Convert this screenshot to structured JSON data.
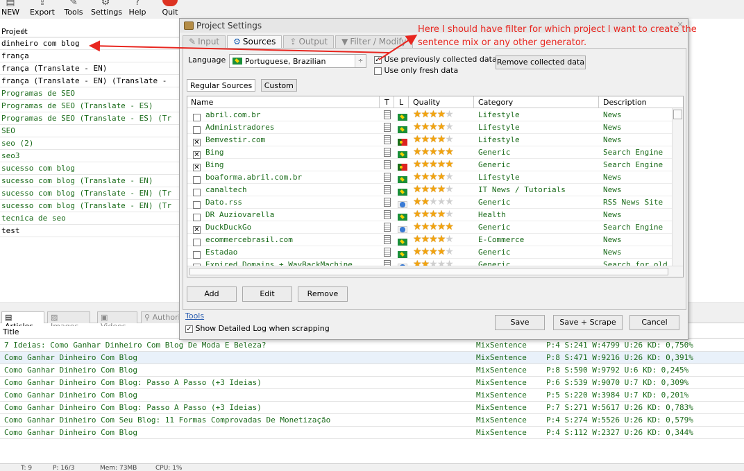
{
  "toolbar": {
    "items": [
      {
        "label": "NEW",
        "icon": "new-icon"
      },
      {
        "label": "Export",
        "icon": "export-icon"
      },
      {
        "label": "Tools",
        "icon": "tools-icon"
      },
      {
        "label": "Settings",
        "icon": "settings-icon"
      },
      {
        "label": "Help",
        "icon": "help-icon"
      },
      {
        "label": "Quit",
        "icon": "quit-icon"
      }
    ]
  },
  "projects": {
    "header": "Project",
    "items": [
      "dinheiro com blog",
      "frança",
      "frança (Translate - EN)",
      "frança (Translate - EN) (Translate -",
      "Programas de SEO",
      "Programas de SEO (Translate - ES)",
      "Programas de SEO (Translate - ES) (Tr",
      "SEO",
      "seo (2)",
      "seo3",
      "sucesso com blog",
      "sucesso com blog (Translate - EN)",
      "sucesso com blog (Translate - EN) (Tr",
      "sucesso com blog (Translate - EN) (Tr",
      "tecnica de seo",
      "test"
    ]
  },
  "dialog": {
    "title": "Project Settings",
    "tabs": [
      "Input",
      "Sources",
      "Output",
      "Filter / Modify"
    ],
    "active_tab": "Sources",
    "language_label": "Language",
    "language_value": "Portuguese, Brazilian",
    "use_previous": "Use previously collected data",
    "use_previous_checked": true,
    "use_fresh": "Use only fresh data",
    "use_fresh_checked": false,
    "remove_collected": "Remove collected data",
    "source_tabs": [
      "Regular Sources",
      "Custom"
    ],
    "columns": {
      "name": "Name",
      "t": "T",
      "l": "L",
      "quality": "Quality",
      "category": "Category",
      "description": "Description"
    },
    "sources": [
      {
        "checked": false,
        "name": "abril.com.br",
        "flag": "br",
        "stars": 4,
        "category": "Lifestyle",
        "description": "News"
      },
      {
        "checked": false,
        "name": "Administradores",
        "flag": "br",
        "stars": 4,
        "category": "Lifestyle",
        "description": "News"
      },
      {
        "checked": true,
        "name": "Bemvestir.com",
        "flag": "pt",
        "stars": 4,
        "category": "Lifestyle",
        "description": "News"
      },
      {
        "checked": true,
        "name": "Bing",
        "flag": "br",
        "stars": 5,
        "category": "Generic",
        "description": "Search Engine"
      },
      {
        "checked": true,
        "name": "Bing",
        "flag": "pt",
        "stars": 5,
        "category": "Generic",
        "description": "Search Engine"
      },
      {
        "checked": false,
        "name": "boaforma.abril.com.br",
        "flag": "br",
        "stars": 4,
        "category": "Lifestyle",
        "description": "News"
      },
      {
        "checked": false,
        "name": "canaltech",
        "flag": "br",
        "stars": 4,
        "category": "IT News / Tutorials",
        "description": "News"
      },
      {
        "checked": false,
        "name": "Dato.rss",
        "flag": "gl",
        "stars": 2,
        "category": "Generic",
        "description": "RSS News Site"
      },
      {
        "checked": false,
        "name": "DR Auziovarella",
        "flag": "br",
        "stars": 4,
        "category": "Health",
        "description": "News"
      },
      {
        "checked": true,
        "name": "DuckDuckGo",
        "flag": "gl",
        "stars": 5,
        "category": "Generic",
        "description": "Search Engine"
      },
      {
        "checked": false,
        "name": "ecommercebrasil.com",
        "flag": "br",
        "stars": 4,
        "category": "E-Commerce",
        "description": "News"
      },
      {
        "checked": false,
        "name": "Estadao",
        "flag": "br",
        "stars": 4,
        "category": "Generic",
        "description": "News"
      },
      {
        "checked": false,
        "name": "Expired Domains + WayBackMachine",
        "flag": "gl",
        "stars": 2,
        "category": "Generic",
        "description": "Search for old"
      }
    ],
    "grid_buttons": [
      "Add",
      "Edit",
      "Remove"
    ],
    "tools_link": "Tools",
    "detail_log": "Show Detailed Log when scrapping",
    "detail_log_checked": true,
    "footer_buttons": [
      "Save",
      "Save + Scrape",
      "Cancel"
    ]
  },
  "annotation": "Here I should have filter for which project I want to create the sentence mix or any other generator.",
  "bottom": {
    "tabs": [
      "Articles",
      "Images",
      "Videos",
      "Authori"
    ],
    "title_header": "Title",
    "articles": [
      {
        "title": "7 Ideias: Como Ganhar Dinheiro Com Blog De Moda E Beleza?",
        "gen": "MixSentence",
        "stats": "P:4 S:241 W:4799 U:26 KD: 0,750%"
      },
      {
        "title": "Como Ganhar Dinheiro Com Blog",
        "gen": "MixSentence",
        "stats": "P:8 S:471 W:9216 U:26 KD: 0,391%"
      },
      {
        "title": "Como Ganhar Dinheiro Com Blog",
        "gen": "MixSentence",
        "stats": "P:8 S:590 W:9792 U:6 KD: 0,245%"
      },
      {
        "title": "Como Ganhar Dinheiro Com Blog: Passo A Passo (+3 Ideias)",
        "gen": "MixSentence",
        "stats": "P:6 S:539 W:9070 U:7 KD: 0,309%"
      },
      {
        "title": "Como Ganhar Dinheiro Com Blog",
        "gen": "MixSentence",
        "stats": "P:5 S:220 W:3984 U:7 KD: 0,201%"
      },
      {
        "title": "Como Ganhar Dinheiro Com Blog: Passo A Passo (+3 Ideias)",
        "gen": "MixSentence",
        "stats": "P:7 S:271 W:5617 U:26 KD: 0,783%"
      },
      {
        "title": "Como Ganhar Dinheiro Com Seu Blog: 11 Formas Comprovadas De Monetização",
        "gen": "MixSentence",
        "stats": "P:4 S:274 W:5526 U:26 KD: 0,579%"
      },
      {
        "title": "Como Ganhar Dinheiro Com Blog",
        "gen": "MixSentence",
        "stats": "P:4 S:112 W:2327 U:26 KD: 0,344%"
      }
    ]
  },
  "status": [
    "T: 9",
    "P: 16/3",
    "Mem: 73MB",
    "CPU: 1%"
  ],
  "colors": {
    "annotation": "#e8261f",
    "green_text": "#1a6b1a",
    "star": "#f2a40f"
  }
}
